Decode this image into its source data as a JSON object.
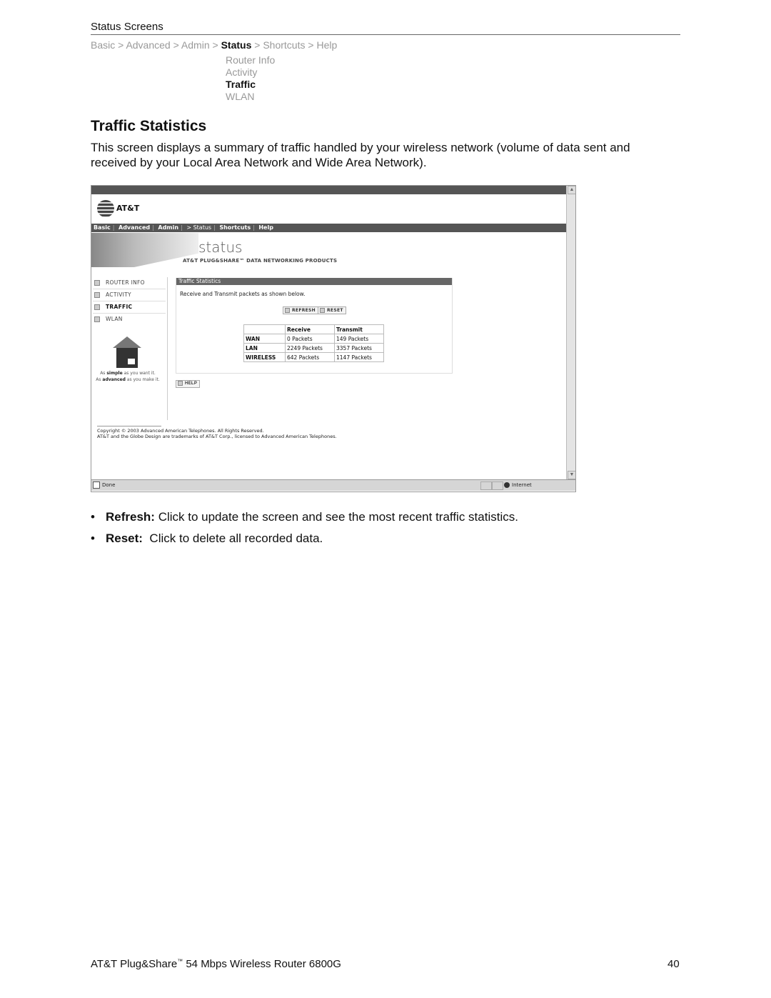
{
  "header": {
    "section": "Status Screens"
  },
  "breadcrumb": {
    "items": [
      "Basic",
      "Advanced",
      "Admin",
      "Status",
      "Shortcuts",
      "Help"
    ],
    "separator": ">",
    "current": "Status"
  },
  "submenu": {
    "items": [
      "Router Info",
      "Activity",
      "Traffic",
      "WLAN"
    ],
    "current": "Traffic"
  },
  "title": "Traffic Statistics",
  "intro": "This screen displays a summary of traffic handled by your wireless network (volume of data sent and received by your Local Area Network and Wide Area Network).",
  "screenshot": {
    "logo_text": "AT&T",
    "nav": {
      "items": [
        "Basic",
        "Advanced",
        "Admin",
        "> Status",
        "Shortcuts",
        "Help"
      ]
    },
    "banner": {
      "title": "status",
      "subtitle": "AT&T PLUG&SHARE™ DATA NETWORKING PRODUCTS"
    },
    "sidebar": {
      "items": [
        "ROUTER INFO",
        "ACTIVITY",
        "TRAFFIC",
        "WLAN"
      ],
      "current": "TRAFFIC",
      "tagline_1_pre": "As ",
      "tagline_1_bold": "simple",
      "tagline_1_post": " as you want it.",
      "tagline_2_pre": "As ",
      "tagline_2_bold": "advanced",
      "tagline_2_post": " as you make it."
    },
    "panel": {
      "heading": "Traffic Statistics",
      "description": "Receive and Transmit packets as shown below.",
      "refresh_label": "REFRESH",
      "reset_label": "RESET",
      "table": {
        "headers": [
          "",
          "Receive",
          "Transmit"
        ],
        "rows": [
          {
            "label": "WAN",
            "receive": "0 Packets",
            "transmit": "149 Packets"
          },
          {
            "label": "LAN",
            "receive": "2249 Packets",
            "transmit": "3357 Packets"
          },
          {
            "label": "WIRELESS",
            "receive": "642 Packets",
            "transmit": "1147 Packets"
          }
        ]
      }
    },
    "help_label": "HELP",
    "copyright_1": "Copyright © 2003 Advanced American Telephones. All Rights Reserved.",
    "copyright_2": "AT&T and the Globe Design are trademarks of AT&T Corp., licensed to Advanced American Telephones.",
    "statusbar": {
      "status": "Done",
      "zone": "Internet"
    }
  },
  "bullets": [
    {
      "term": "Refresh:",
      "text": " Click to update the screen and see the most recent traffic statistics."
    },
    {
      "term": "Reset:",
      "text": "  Click to delete all recorded data."
    }
  ],
  "footer": {
    "product_pre": "AT&T Plug&Share",
    "tm": "™",
    "product_post": " 54 Mbps Wireless Router 6800G",
    "page": "40"
  }
}
